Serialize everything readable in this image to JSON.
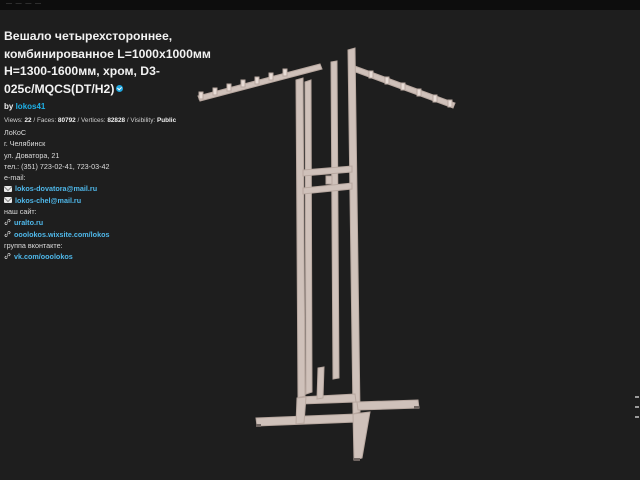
{
  "topbar": {
    "fragment": "—  —    — —"
  },
  "model": {
    "title": "Вешало четырехстороннее, комбинированное L=1000x1000мм H=1300-1600мм, хром, D3-025с/MQCS(DT/H2)",
    "by_prefix": "by",
    "author": "lokos41",
    "stats": {
      "views_label": "Views:",
      "views": "22",
      "faces_label": "Faces:",
      "faces": "80792",
      "vertices_label": "Vertices:",
      "vertices": "82828",
      "visibility_label": "Visibility:",
      "visibility": "Public"
    }
  },
  "description": {
    "company": "ЛоКоС",
    "city": "г. Челябинск",
    "street": "ул. Доватора, 21",
    "phone": "тел.: (351) 723-02-41, 723-03-42",
    "email_label": "e-mail:",
    "email1": "lokos-dovatora@mail.ru",
    "email2": "lokos-chel@mail.ru",
    "site_label": "наш сайт:",
    "site1": "uralto.ru",
    "site2": "ooolokos.wixsite.com/lokos",
    "vk_label": "группа вконтакте:",
    "vk": "vk.com/ooolokos"
  },
  "colors": {
    "background": "#1e1e1e",
    "link": "#4fb8ea",
    "frame": "#c4b5ae"
  },
  "icons": [
    "verified-icon",
    "mail-icon",
    "link-icon"
  ]
}
